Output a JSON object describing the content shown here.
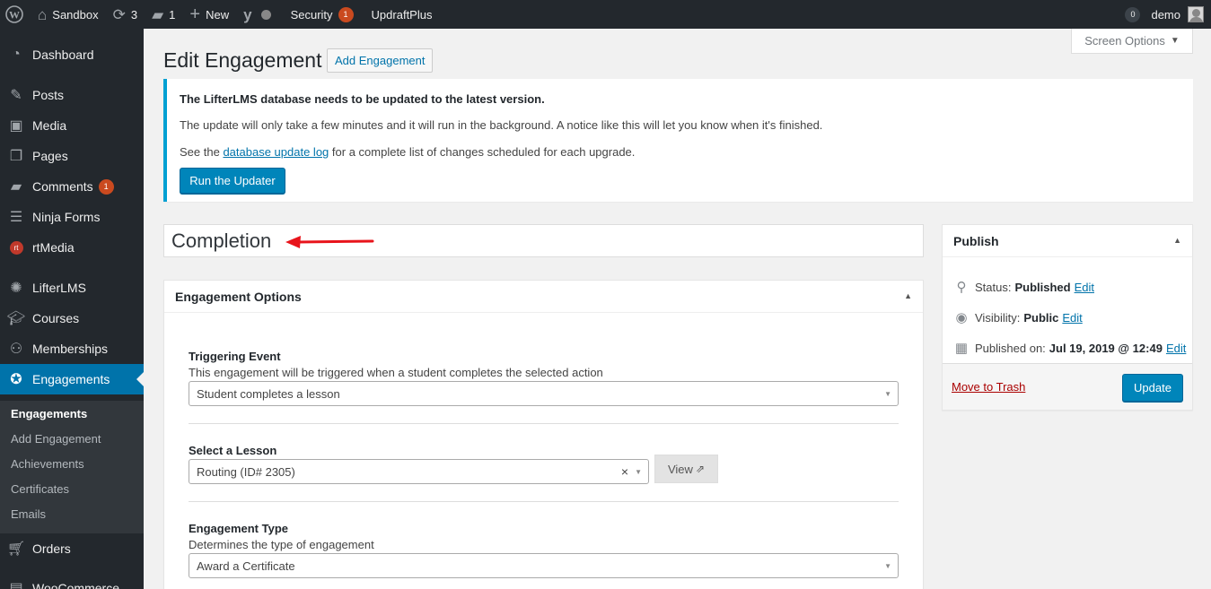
{
  "adminbar": {
    "site_name": "Sandbox",
    "updates_count": "3",
    "comments_count": "1",
    "new_label": "New",
    "security_label": "Security",
    "security_count": "1",
    "updraft_label": "UpdraftPlus",
    "notifications_count": "0",
    "user_name": "demo"
  },
  "sidebar": {
    "items": [
      {
        "label": "Dashboard",
        "icon": "dashboard-icon"
      },
      {
        "label": "Posts",
        "icon": "pin-icon"
      },
      {
        "label": "Media",
        "icon": "media-icon"
      },
      {
        "label": "Pages",
        "icon": "pages-icon"
      },
      {
        "label": "Comments",
        "icon": "comment-icon",
        "badge": "1"
      },
      {
        "label": "Ninja Forms",
        "icon": "forms-icon"
      },
      {
        "label": "rtMedia",
        "icon": "rtmedia-icon"
      },
      {
        "label": "LifterLMS",
        "icon": "lifterlms-icon"
      },
      {
        "label": "Courses",
        "icon": "courses-icon"
      },
      {
        "label": "Memberships",
        "icon": "groups-icon"
      },
      {
        "label": "Engagements",
        "icon": "award-icon"
      },
      {
        "label": "Orders",
        "icon": "cart-icon"
      },
      {
        "label": "WooCommerce",
        "icon": "woo-icon"
      }
    ],
    "submenu": [
      "Engagements",
      "Add Engagement",
      "Achievements",
      "Certificates",
      "Emails"
    ]
  },
  "screen_options": "Screen Options",
  "page": {
    "title": "Edit Engagement",
    "add_button": "Add Engagement"
  },
  "notice": {
    "heading": "The LifterLMS database needs to be updated to the latest version.",
    "line1": "The update will only take a few minutes and it will run in the background. A notice like this will let you know when it's finished.",
    "line2_before": "See the",
    "line2_link": "database update log",
    "line2_after": "for a complete list of changes scheduled for each upgrade.",
    "button": "Run the Updater"
  },
  "post_title": "Completion",
  "engagement_options": {
    "heading": "Engagement Options",
    "triggering_event_label": "Triggering Event",
    "triggering_event_desc": "This engagement will be triggered when a student completes the selected action",
    "triggering_event_value": "Student completes a lesson",
    "lesson_label": "Select a Lesson",
    "lesson_value": "Routing (ID# 2305)",
    "view_button": "View",
    "type_label": "Engagement Type",
    "type_desc": "Determines the type of engagement",
    "type_value": "Award a Certificate"
  },
  "publish": {
    "heading": "Publish",
    "status_label": "Status:",
    "status_value": "Published",
    "visibility_label": "Visibility:",
    "visibility_value": "Public",
    "published_label": "Published on:",
    "published_value": "Jul 19, 2019 @ 12:49",
    "edit_label": "Edit",
    "trash_label": "Move to Trash",
    "update_button": "Update"
  },
  "colors": {
    "adminbar_bg": "#23282d",
    "accent": "#0073aa",
    "primary_button": "#0085ba",
    "notice_border": "#00a0d2",
    "badge": "#ca4a1f",
    "annotation_arrow": "#e8141b"
  }
}
